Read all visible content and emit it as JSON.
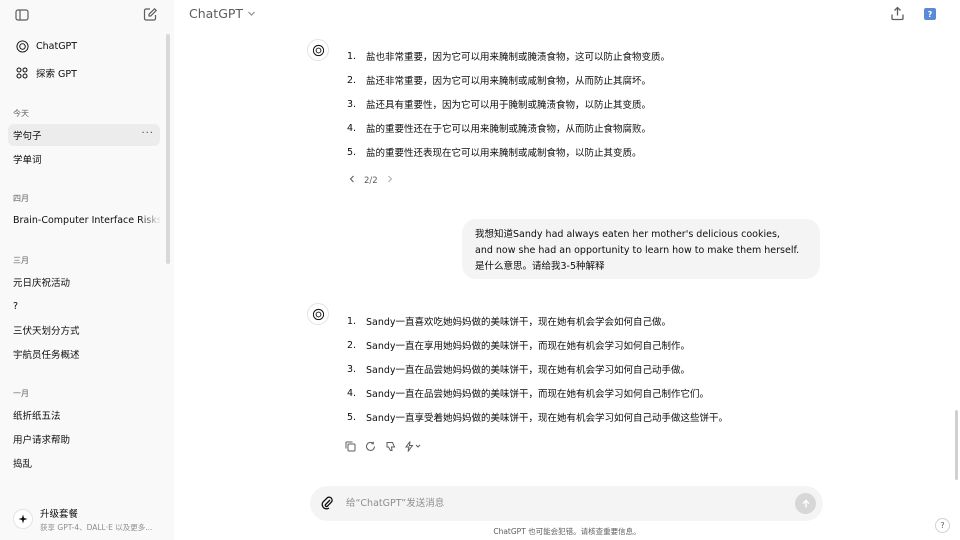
{
  "sidebar": {
    "nav": [
      {
        "label": "ChatGPT",
        "icon": "openai-logo-icon"
      },
      {
        "label": "探索 GPT",
        "icon": "grid-icon"
      }
    ],
    "sections": [
      {
        "title": "今天",
        "items": [
          "学句子",
          "学单词"
        ]
      },
      {
        "title": "四月",
        "items": [
          "Brain-Computer Interface Risks"
        ]
      },
      {
        "title": "三月",
        "items": [
          "元日庆祝活动",
          "?",
          "三伏天划分方式",
          "宇航员任务概述"
        ]
      },
      {
        "title": "一月",
        "items": [
          "纸折纸五法",
          "用户请求帮助",
          "捣乱"
        ]
      }
    ],
    "active_item": "学句子",
    "upgrade": {
      "title": "升级套餐",
      "subtitle": "获享 GPT-4、DALL·E 以及更多..."
    }
  },
  "header": {
    "title": "ChatGPT"
  },
  "conversation": {
    "first_answer": [
      {
        "num": "1.",
        "text": "盐也非常重要，因为它可以用来腌制或腌渍食物，这可以防止食物变质。"
      },
      {
        "num": "2.",
        "text": "盐还非常重要，因为它可以用来腌制或咸制食物，从而防止其腐坏。"
      },
      {
        "num": "3.",
        "text": "盐还具有重要性，因为它可以用于腌制或腌渍食物，以防止其变质。"
      },
      {
        "num": "4.",
        "text": "盐的重要性还在于它可以用来腌制或腌渍食物，从而防止食物腐败。"
      },
      {
        "num": "5.",
        "text": "盐的重要性还表现在它可以用来腌制或咸制食物，以防止其变质。"
      }
    ],
    "pager": "2/2",
    "user_message": {
      "line1": "我想知道Sandy had always eaten her mother's delicious cookies,",
      "line2": "and now she had an opportunity to learn how to make them herself.",
      "line3": "是什么意思。请给我3-5种解释"
    },
    "second_answer": [
      {
        "num": "1.",
        "text": "Sandy一直喜欢吃她妈妈做的美味饼干，现在她有机会学会如何自己做。"
      },
      {
        "num": "2.",
        "text": "Sandy一直在享用她妈妈做的美味饼干，而现在她有机会学习如何自己制作。"
      },
      {
        "num": "3.",
        "text": "Sandy一直在品尝她妈妈做的美味饼干，现在她有机会学习如何自己动手做。"
      },
      {
        "num": "4.",
        "text": "Sandy一直在品尝她妈妈做的美味饼干，而现在她有机会学习如何自己制作它们。"
      },
      {
        "num": "5.",
        "text": "Sandy一直享受着她妈妈做的美味饼干，现在她有机会学习如何自己动手做这些饼干。"
      }
    ]
  },
  "composer": {
    "placeholder": "给“ChatGPT”发送消息"
  },
  "disclaimer": "ChatGPT 也可能会犯错。请核查重要信息。",
  "help": "?",
  "avatar_letter": "?"
}
